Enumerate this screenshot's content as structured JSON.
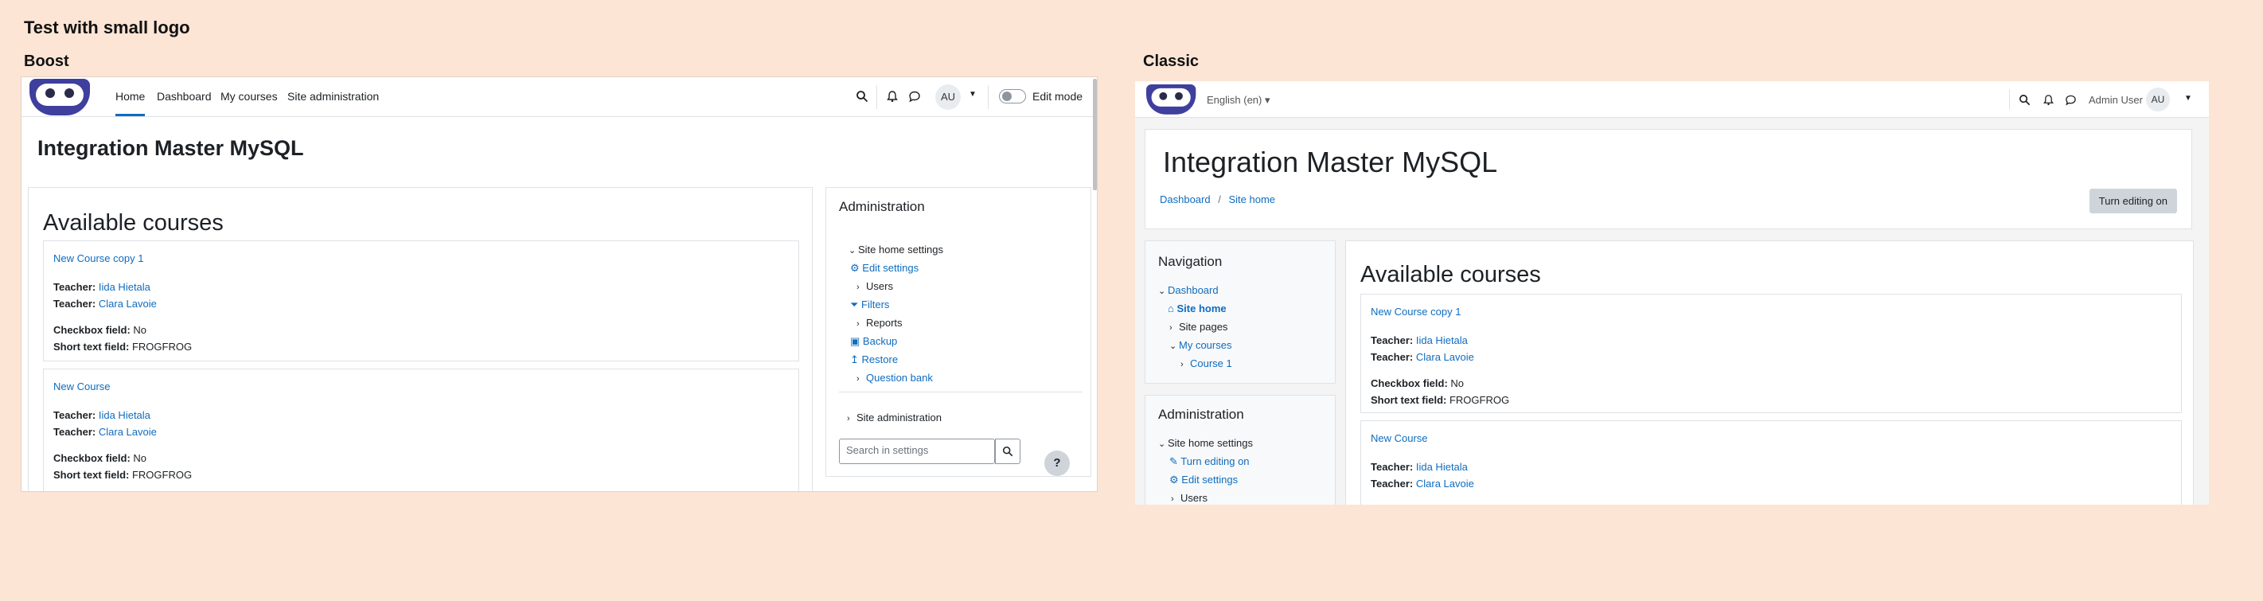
{
  "page": {
    "title": "Test with small logo"
  },
  "boost": {
    "heading": "Boost",
    "nav": {
      "home": "Home",
      "dashboard": "Dashboard",
      "my_courses": "My courses",
      "site_admin": "Site administration",
      "avatar": "AU",
      "edit_mode": "Edit mode"
    },
    "site_title": "Integration Master MySQL",
    "available_courses": "Available courses",
    "courses": [
      {
        "name": "New Course copy 1",
        "teacher_label": "Teacher:",
        "teachers": [
          "Iida Hietala",
          "Clara Lavoie"
        ],
        "checkbox_label": "Checkbox field:",
        "checkbox_value": "No",
        "short_label": "Short text field:",
        "short_value": "FROGFROG"
      },
      {
        "name": "New Course",
        "teacher_label": "Teacher:",
        "teachers": [
          "Iida Hietala",
          "Clara Lavoie"
        ],
        "checkbox_label": "Checkbox field:",
        "checkbox_value": "No",
        "short_label": "Short text field:",
        "short_value": "FROGFROG"
      }
    ],
    "admin": {
      "title": "Administration",
      "items": [
        "Site home settings",
        "Edit settings",
        "Users",
        "Filters",
        "Reports",
        "Backup",
        "Restore",
        "Question bank",
        "Site administration"
      ],
      "search_placeholder": "Search in settings",
      "help": "?"
    }
  },
  "classic": {
    "heading": "Classic",
    "nav": {
      "language": "English (en) ▾",
      "user_name": "Admin User",
      "avatar": "AU"
    },
    "site_title": "Integration Master MySQL",
    "breadcrumb": [
      "Dashboard",
      "Site home"
    ],
    "breadcrumb_sep": "/",
    "edit_button": "Turn editing on",
    "navigation": {
      "title": "Navigation",
      "items": [
        "Dashboard",
        "Site home",
        "Site pages",
        "My courses",
        "Course 1"
      ]
    },
    "admin": {
      "title": "Administration",
      "items": [
        "Site home settings",
        "Turn editing on",
        "Edit settings",
        "Users"
      ]
    },
    "available_courses": "Available courses",
    "courses": [
      {
        "name": "New Course copy 1",
        "teacher_label": "Teacher:",
        "teachers": [
          "Iida Hietala",
          "Clara Lavoie"
        ],
        "checkbox_label": "Checkbox field:",
        "checkbox_value": "No",
        "short_label": "Short text field:",
        "short_value": "FROGFROG"
      },
      {
        "name": "New Course",
        "teacher_label": "Teacher:",
        "teachers": [
          "Iida Hietala",
          "Clara Lavoie"
        ]
      }
    ]
  }
}
